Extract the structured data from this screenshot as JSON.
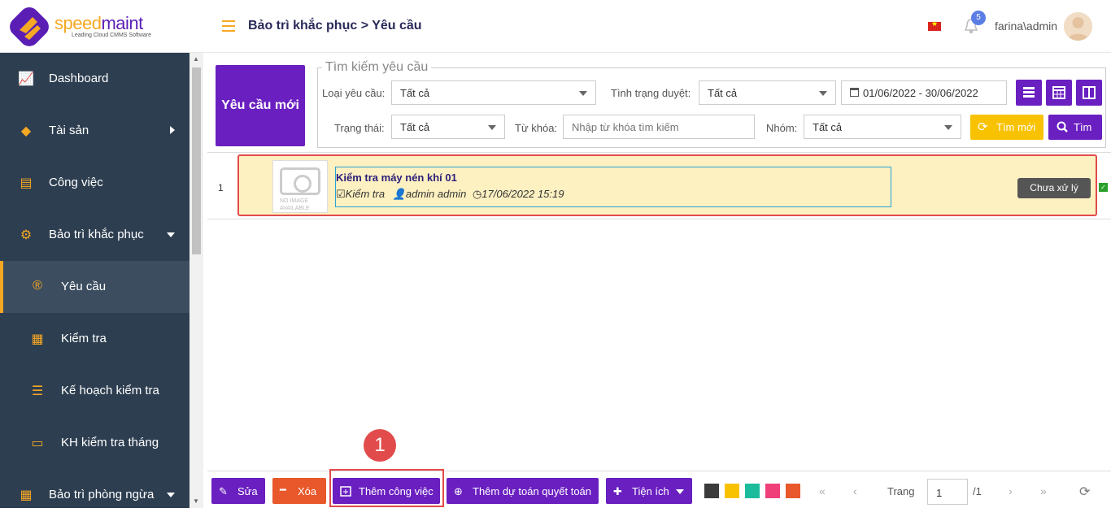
{
  "brand": {
    "name_part1": "speed",
    "name_part2": "maint",
    "tagline": "Leading Cloud CMMS Software"
  },
  "header": {
    "breadcrumb": "Bảo trì khắc phục > Yêu cầu",
    "notification_count": "5",
    "user": "farina\\admin"
  },
  "sidebar": {
    "items": [
      {
        "label": "Dashboard",
        "icon": "chart-icon"
      },
      {
        "label": "Tài sản",
        "icon": "boxes-icon"
      },
      {
        "label": "Công việc",
        "icon": "task-icon"
      },
      {
        "label": "Bảo trì khắc phục",
        "icon": "tools-icon"
      },
      {
        "label": "Yêu cầu",
        "icon": "request-icon"
      },
      {
        "label": "Kiểm tra",
        "icon": "document-icon"
      },
      {
        "label": "Kế hoạch kiểm tra",
        "icon": "list-icon"
      },
      {
        "label": "KH kiểm tra tháng",
        "icon": "calendar-icon"
      },
      {
        "label": "Bảo trì phòng ngừa",
        "icon": "calendar-grid-icon"
      }
    ],
    "active": "Yêu cầu"
  },
  "actions": {
    "new_request": "Yêu cầu mới"
  },
  "search": {
    "legend": "Tìm kiếm yêu cầu",
    "request_type_label": "Loại yêu cầu:",
    "request_type_value": "Tất cả",
    "approval_label": "Tình trạng duyệt:",
    "approval_value": "Tất cả",
    "date_range": "01/06/2022 - 30/06/2022",
    "status_label": "Trạng thái:",
    "status_value": "Tất cả",
    "keyword_label": "Từ khóa:",
    "keyword_placeholder": "Nhập từ khóa tìm kiếm",
    "group_label": "Nhóm:",
    "group_value": "Tất cả",
    "reset_label": "Tìm mới",
    "search_label": "Tìm"
  },
  "list": {
    "rows": [
      {
        "index": "1",
        "no_image": "NO IMAGE AVAILABLE",
        "title": "Kiểm tra máy nén khí 01",
        "type": "Kiểm tra",
        "user": "admin admin",
        "datetime": "17/06/2022 15:19",
        "status": "Chưa xử lý"
      }
    ]
  },
  "marker": "1",
  "toolbar": {
    "edit": "Sửa",
    "delete": "Xóa",
    "add_task": "Thêm công việc",
    "add_estimate": "Thêm dự toán quyết toán",
    "utilities": "Tiện ích",
    "swatches": [
      "#3b3b3b",
      "#f9c200",
      "#1abc9c",
      "#f0407a",
      "#e8582b"
    ],
    "page_label": "Trang",
    "page_value": "1",
    "page_total": "/1"
  },
  "colors": {
    "accent": "#6a1fc0",
    "brand": "#f7a823",
    "sidebar": "#2d3e50",
    "highlight": "#e24b4b"
  }
}
